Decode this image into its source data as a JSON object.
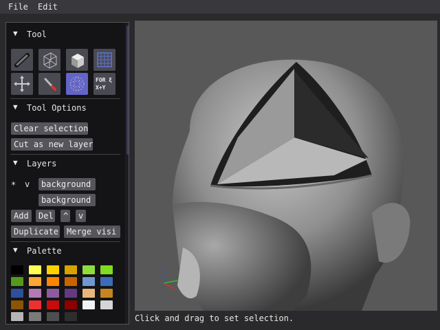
{
  "menu": {
    "file": "File",
    "edit": "Edit"
  },
  "sections": {
    "tool": "Tool",
    "tool_options": "Tool Options",
    "layers": "Layers",
    "palette": "Palette"
  },
  "tools": [
    {
      "name": "pencil-tool",
      "icon": "pencil-icon",
      "active": false
    },
    {
      "name": "wireframe-cube-tool",
      "icon": "wireframe-cube-icon",
      "active": false
    },
    {
      "name": "solid-cube-tool",
      "icon": "solid-cube-icon",
      "active": false
    },
    {
      "name": "grid-tool",
      "icon": "grid-icon",
      "active": false
    },
    {
      "name": "move-tool",
      "icon": "move-arrows-icon",
      "active": false
    },
    {
      "name": "brush-tool",
      "icon": "brush-icon",
      "active": false
    },
    {
      "name": "sphere-selection-tool",
      "icon": "sphere-selection-icon",
      "active": true
    },
    {
      "name": "script-tool",
      "icon": "script-icon",
      "active": false
    }
  ],
  "script_icon_text": {
    "line1": "FOR ξ",
    "line2": "X+Y"
  },
  "tool_options": {
    "clear_selection": "Clear selection",
    "cut_as_new_layer": "Cut as new layer"
  },
  "layers": {
    "active_marker": "*",
    "visible_marker": "v",
    "items": [
      "background",
      "background"
    ],
    "add": "Add",
    "delete": "Del",
    "move_up": "^",
    "move_down": "v",
    "duplicate": "Duplicate",
    "merge_visible": "Merge visi"
  },
  "palette": [
    "#000000",
    "#fefe55",
    "#fcd100",
    "#d6a300",
    "#8edd3a",
    "#7fdc20",
    "#559a1a",
    "#fda636",
    "#fc8500",
    "#c96400",
    "#6f97d2",
    "#3a6cb9",
    "#2d4f9d",
    "#b37ab5",
    "#8d5ba0",
    "#633a82",
    "#e7b77a",
    "#c6851e",
    "#8a5605",
    "#ee3030",
    "#c80b0b",
    "#8d0000",
    "#f2f2f2",
    "#d5d5d5",
    "#b5b5b5",
    "#7a7a7a",
    "#4e4e4e",
    "#2e2e2e"
  ],
  "status": "Click and drag to set selection.",
  "colors": {
    "accent": "#6264c8",
    "panel": "#141416",
    "button": "#55555b",
    "viewport": "#585858"
  }
}
